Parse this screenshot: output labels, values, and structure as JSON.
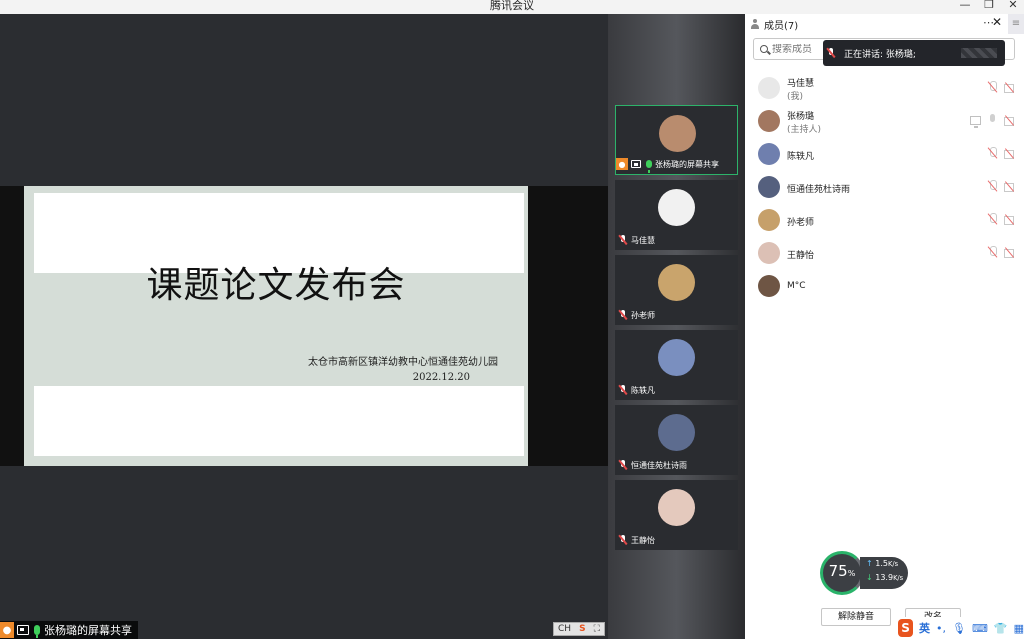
{
  "app": {
    "title": "腾讯会议"
  },
  "stage": {
    "slide": {
      "title": "课题论文发布会",
      "organization": "太仓市高新区镇洋幼教中心恒通佳苑幼儿园",
      "date": "2022.12.20"
    },
    "share_label": "张杨璐的屏幕共享",
    "ime_mini": {
      "lang": "CH",
      "logo": "S"
    }
  },
  "video_strip": {
    "tiles": [
      {
        "name": "张杨璐的屏幕共享",
        "active": true,
        "avatar_color": "#b98c6e"
      },
      {
        "name": "马佳慧",
        "active": false,
        "avatar_color": "#f1f1f1"
      },
      {
        "name": "孙老师",
        "active": false,
        "avatar_color": "#c9a46c"
      },
      {
        "name": "陈轶凡",
        "active": false,
        "avatar_color": "#7a8fbf"
      },
      {
        "name": "恒通佳苑杜诗雨",
        "active": false,
        "avatar_color": "#5d6c8f"
      },
      {
        "name": "王静怡",
        "active": false,
        "avatar_color": "#e4c9bd"
      }
    ]
  },
  "panel": {
    "title": "成员(7)",
    "search_placeholder": "搜索成员",
    "speaking": "正在讲话: 张杨璐;",
    "members": [
      {
        "name": "马佳慧",
        "role": "(我)",
        "avatar_color": "#e8e8e8"
      },
      {
        "name": "张杨璐",
        "role": "(主持人)",
        "avatar_color": "#a27760"
      },
      {
        "name": "陈轶凡",
        "role": "",
        "avatar_color": "#6f7fae"
      },
      {
        "name": "恒通佳苑杜诗雨",
        "role": "",
        "avatar_color": "#55607e"
      },
      {
        "name": "孙老师",
        "role": "",
        "avatar_color": "#c6a06a"
      },
      {
        "name": "王静怡",
        "role": "",
        "avatar_color": "#dcc0b5"
      },
      {
        "name": "M°C",
        "role": "",
        "avatar_color": "#6e5544"
      }
    ],
    "unmute_button": "解除静音",
    "rename_button": "改名"
  },
  "network": {
    "percent": "75",
    "unit": "%",
    "upload": "1.5",
    "upload_unit": "K/s",
    "download": "13.9",
    "download_unit": "K/s"
  },
  "ime_bar": {
    "logo": "S",
    "lang": "英"
  }
}
